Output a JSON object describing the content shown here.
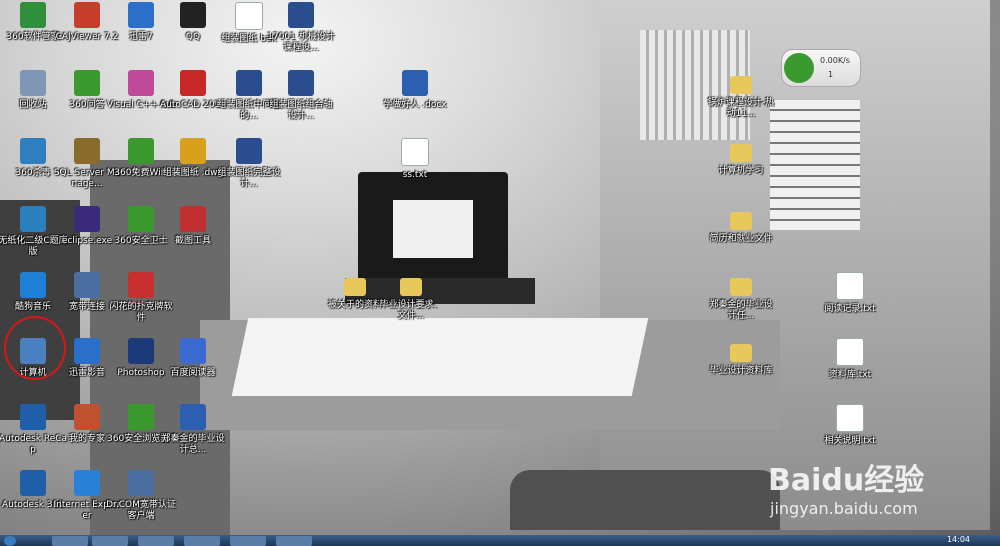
{
  "desktop": {
    "icons": [
      {
        "label": "360软件管家",
        "icon": "360-software-manager-icon",
        "color": "#2f8f3a"
      },
      {
        "label": "CAJViewer 7.2",
        "icon": "cajviewer-icon",
        "color": "#c83c2c"
      },
      {
        "label": "迅雷7",
        "icon": "thunder-icon",
        "color": "#2a6fc9"
      },
      {
        "label": "QQ",
        "icon": "qq-icon",
        "color": "#222222"
      },
      {
        "label": "组装图纸 bak",
        "icon": "file-icon",
        "color": "#ffffff"
      },
      {
        "label": "17001 机械设计课程设...",
        "icon": "caj-file-icon",
        "color": "#2a4d8f"
      },
      {
        "label": "回收站",
        "icon": "recycle-bin-icon",
        "color": "#7d97b5"
      },
      {
        "label": "360问答",
        "icon": "360-qa-icon",
        "color": "#3a9a2e"
      },
      {
        "label": "Visual C++ 6.0",
        "icon": "visual-cpp-icon",
        "color": "#c04a9a"
      },
      {
        "label": "AutoCAD 2014",
        "icon": "autocad-icon",
        "color": "#c62828"
      },
      {
        "label": "组装图纸中间轴的...",
        "icon": "caj-file-icon",
        "color": "#2a4d8f"
      },
      {
        "label": "组装图纸组合轴设计...",
        "icon": "caj-file-icon",
        "color": "#2a4d8f"
      },
      {
        "label": "学做好人 .docx",
        "icon": "word-doc-icon",
        "color": "#2b5fb0"
      },
      {
        "label": "360杀毒",
        "icon": "360-antivirus-icon",
        "color": "#2e7fc0"
      },
      {
        "label": "SQL Server Manage...",
        "icon": "sql-server-icon",
        "color": "#8a6b2a"
      },
      {
        "label": "360免费WiFi",
        "icon": "360-wifi-icon",
        "color": "#3a9a2e"
      },
      {
        "label": "组装图纸 .dwg",
        "icon": "dwg-file-icon",
        "color": "#d9a020"
      },
      {
        "label": "组装图纸完整设计...",
        "icon": "caj-file-icon",
        "color": "#2a4d8f"
      },
      {
        "label": "ss.txt",
        "icon": "txt-file-icon",
        "color": "#ffffff"
      },
      {
        "label": "无纸化二级C题库版",
        "icon": "exam-app-icon",
        "color": "#2a7fbf"
      },
      {
        "label": "eclipse.exe",
        "icon": "eclipse-icon",
        "color": "#3c2a7a"
      },
      {
        "label": "360安全卫士",
        "icon": "360-security-icon",
        "color": "#3a9a2e"
      },
      {
        "label": "截图工具",
        "icon": "snipping-tool-icon",
        "color": "#c03030"
      },
      {
        "label": "酷狗音乐",
        "icon": "kugou-icon",
        "color": "#1e7fd6"
      },
      {
        "label": "宽带连接",
        "icon": "broadband-icon",
        "color": "#4a6fa0"
      },
      {
        "label": "闪花的扑克牌软件",
        "icon": "cards-icon",
        "color": "#c83030"
      },
      {
        "label": "计算机",
        "icon": "computer-icon",
        "color": "#4a7fc0"
      },
      {
        "label": "迅雷影音",
        "icon": "thunder-player-icon",
        "color": "#2a6fc9"
      },
      {
        "label": "Photoshop",
        "icon": "photoshop-icon",
        "color": "#1a3a7a"
      },
      {
        "label": "百度阅读器",
        "icon": "baidu-reader-icon",
        "color": "#3a6ad0"
      },
      {
        "label": "Autodesk ReCap",
        "icon": "autodesk-recap-icon",
        "color": "#1e5fa8"
      },
      {
        "label": "我的专家",
        "icon": "my-expert-icon",
        "color": "#c05030"
      },
      {
        "label": "360安全浏览器7",
        "icon": "360-browser-icon",
        "color": "#3a9a2e"
      },
      {
        "label": "郑秦金的毕业设计总...",
        "icon": "word-doc-icon",
        "color": "#2b5fb0"
      },
      {
        "label": "Autodesk 360",
        "icon": "autodesk-360-icon",
        "color": "#1e5fa8"
      },
      {
        "label": "Internet Explorer",
        "icon": "ie-icon",
        "color": "#2a7fd6"
      },
      {
        "label": "Dr.COM宽带认证客户端",
        "icon": "drcom-icon",
        "color": "#4a6fa0"
      },
      {
        "label": "被关于的资料",
        "icon": "folder-icon",
        "color": "#e8c85a"
      },
      {
        "label": "毕业设计要求、文件...",
        "icon": "folder-icon",
        "color": "#e8c85a"
      },
      {
        "label": "锅炉课程设计-热动11...",
        "icon": "folder-icon",
        "color": "#e8c85a"
      },
      {
        "label": "计算机学习",
        "icon": "folder-icon",
        "color": "#e8c85a"
      },
      {
        "label": "简历和就业文件",
        "icon": "folder-icon",
        "color": "#e8c85a"
      },
      {
        "label": "郑秦金的毕业设计任...",
        "icon": "folder-icon",
        "color": "#e8c85a"
      },
      {
        "label": "阅读记录.txt",
        "icon": "txt-file-icon",
        "color": "#ffffff"
      },
      {
        "label": "毕业设计资料库",
        "icon": "folder-icon",
        "color": "#e8c85a"
      },
      {
        "label": "资料库.txt",
        "icon": "txt-file-icon",
        "color": "#ffffff"
      },
      {
        "label": "相关说明.txt",
        "icon": "txt-file-icon",
        "color": "#ffffff"
      }
    ]
  },
  "net_widget": {
    "speed": "0.00K/s",
    "count": "1",
    "accent": "#3a9a2e"
  },
  "watermark": {
    "brand": "Baidu经验",
    "url": "jingyan.baidu.com"
  },
  "taskbar": {
    "clock": "14:04"
  },
  "annotation": {
    "highlight_color": "#d81818"
  }
}
